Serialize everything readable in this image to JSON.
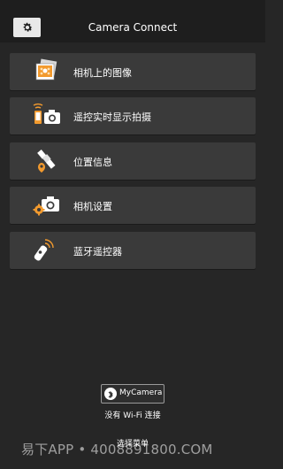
{
  "header": {
    "title": "Camera Connect",
    "settings_icon": "gear-icon"
  },
  "menu": [
    {
      "label": "相机上的图像",
      "icon": "photos-icon"
    },
    {
      "label": "遥控实时显示拍摄",
      "icon": "remote-camera-icon"
    },
    {
      "label": "位置信息",
      "icon": "satellite-location-icon"
    },
    {
      "label": "相机设置",
      "icon": "camera-gear-icon"
    },
    {
      "label": "蓝牙遥控器",
      "icon": "bluetooth-remote-icon"
    }
  ],
  "footer": {
    "camera_button_label": "MyCamera",
    "camera_button_icon": "bluetooth-icon",
    "wifi_status": "没有 Wi-Fi 连接",
    "select_menu": "选择菜单"
  },
  "watermark": "易下APP • 4008891800.COM",
  "colors": {
    "background": "#262626",
    "header": "#1e1e1e",
    "menu_item": "#3a3a3a",
    "accent": "#f29a2e"
  }
}
